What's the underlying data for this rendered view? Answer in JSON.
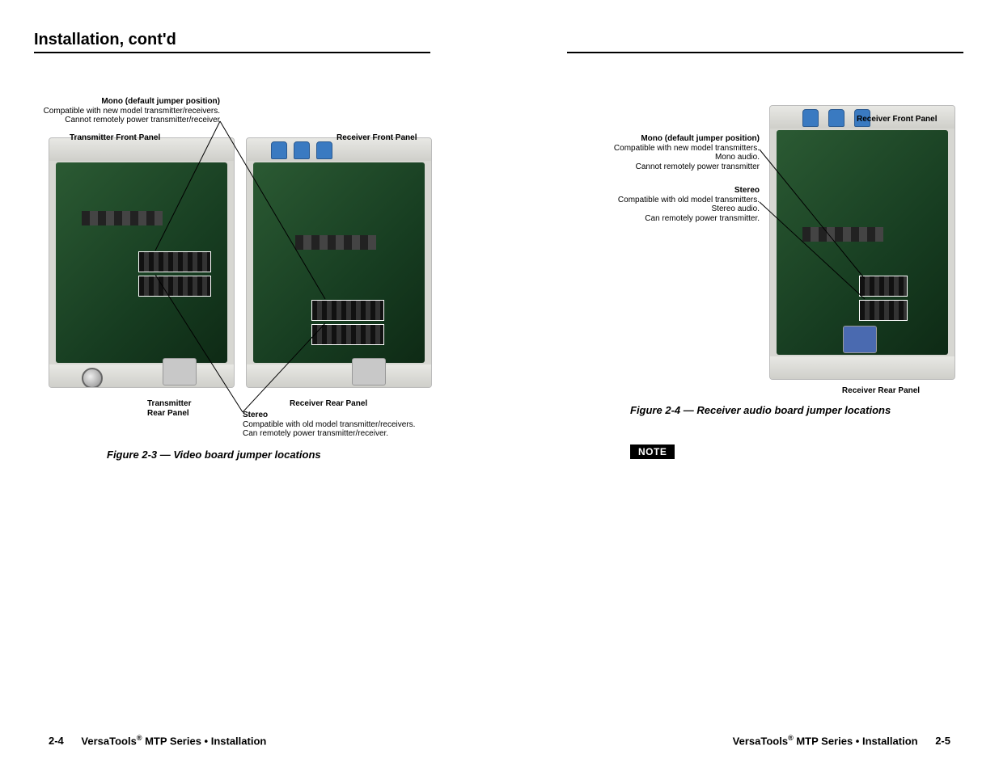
{
  "section_title": "Installation, cont'd",
  "left": {
    "mono": {
      "title": "Mono (default jumper position)",
      "l1": "Compatible with new model transmitter/receivers.",
      "l2": "Cannot remotely power transmitter/receiver"
    },
    "stereo": {
      "title": "Stereo",
      "l1": "Compatible with old model transmitter/receivers.",
      "l2": "Can remotely power transmitter/receiver."
    },
    "labels": {
      "tx_front": "Transmitter Front Panel",
      "rx_front": "Receiver Front Panel",
      "tx_rear_a": "Transmitter",
      "tx_rear_b": "Rear Panel",
      "rx_rear": "Receiver Rear Panel"
    },
    "caption": "Figure 2-3 — Video board jumper locations"
  },
  "right": {
    "mono": {
      "title": "Mono (default jumper position)",
      "l1": "Compatible with new model transmitters.",
      "l2": "Mono audio.",
      "l3": "Cannot remotely power transmitter"
    },
    "stereo": {
      "title": "Stereo",
      "l1": "Compatible with old model transmitters.",
      "l2": "Stereo audio.",
      "l3": "Can remotely power transmitter."
    },
    "labels": {
      "rx_front": "Receiver Front Panel",
      "rx_rear": "Receiver Rear Panel"
    },
    "caption": "Figure 2-4 — Receiver audio board jumper locations",
    "note": "NOTE"
  },
  "footer": {
    "brand": "VersaTools",
    "reg": "®",
    "rest": " MTP Series • Installation",
    "page_left": "2-4",
    "page_right": "2-5"
  }
}
